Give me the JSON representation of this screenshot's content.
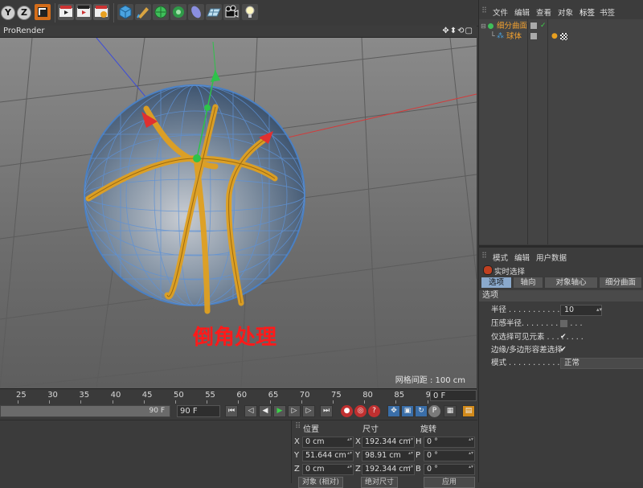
{
  "toolbar": {
    "axis_y": "Y",
    "axis_z": "Z"
  },
  "viewport": {
    "title": "ProRender",
    "nav_icons": "✥⬍⟲▢",
    "grid_info": "网格间距 : 100 cm",
    "caption": "倒角处理"
  },
  "timeline": {
    "ticks": [
      "25",
      "30",
      "35",
      "40",
      "45",
      "50",
      "55",
      "60",
      "65",
      "70",
      "75",
      "80",
      "85",
      "90"
    ],
    "frame_current": "0 F",
    "range_end": "90 F",
    "frame_field": "90 F"
  },
  "coordinates": {
    "headers": {
      "position": "位置",
      "size": "尺寸",
      "rotation": "旋转"
    },
    "rows": [
      {
        "pos_axis": "X",
        "pos": "0 cm",
        "size_axis": "X",
        "size": "192.344 cm",
        "rot_axis": "H",
        "rot": "0 °"
      },
      {
        "pos_axis": "Y",
        "pos": "51.644 cm",
        "size_axis": "Y",
        "size": "98.91 cm",
        "rot_axis": "P",
        "rot": "0 °"
      },
      {
        "pos_axis": "Z",
        "pos": "0 cm",
        "size_axis": "Z",
        "size": "192.344 cm",
        "rot_axis": "B",
        "rot": "0 °"
      }
    ],
    "mode_select": "对象 (相对)",
    "size_select": "绝对尺寸",
    "apply_button": "应用"
  },
  "object_manager": {
    "menu": [
      "文件",
      "编辑",
      "查看",
      "对象",
      "标签",
      "书签"
    ],
    "active_menu": "标签",
    "objects": [
      {
        "name": "细分曲面",
        "color": "#f0a030"
      },
      {
        "name": "球体",
        "color": "#f0a030"
      }
    ]
  },
  "attribute_manager": {
    "menu": [
      "模式",
      "编辑",
      "用户数据"
    ],
    "title": "实时选择",
    "tabs": [
      "选项",
      "轴向",
      "对象轴心",
      "细分曲面"
    ],
    "active_tab": "选项",
    "section": "选项",
    "properties": [
      {
        "label": "半径 . . . . . . . . . . . . . . . .",
        "value": "10"
      },
      {
        "label": "压感半径. . . . . . . . . . . . ."
      },
      {
        "label": "仅选择可见元素 . . . . . . . ."
      },
      {
        "label": "边缘/多边形容差选择"
      },
      {
        "label": "模式 . . . . . . . . . . . . . . . .",
        "value": "正常"
      }
    ]
  }
}
